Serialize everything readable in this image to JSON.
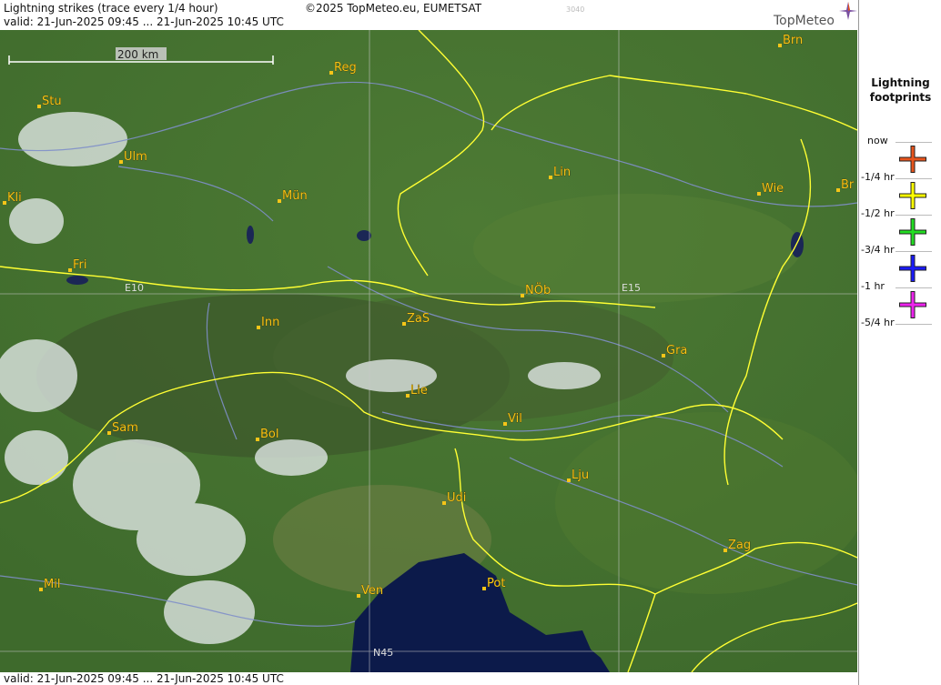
{
  "header": {
    "title": "Lightning strikes (trace every 1/4 hour)",
    "copyright": "©2025 TopMeteo.eu, EUMETSAT",
    "code": "3040",
    "valid": "valid:  21-Jun-2025 09:45 ... 21-Jun-2025 10:45 UTC",
    "logo_text": "TopMeteo"
  },
  "footer": {
    "valid": "valid:  21-Jun-2025 09:45 ... 21-Jun-2025 10:45 UTC"
  },
  "map": {
    "scale_label": "200 km",
    "grid_labels": [
      "E10",
      "E15",
      "N45"
    ],
    "cities": [
      {
        "name": "Brn"
      },
      {
        "name": "Reg"
      },
      {
        "name": "Stu"
      },
      {
        "name": "Ulm"
      },
      {
        "name": "Lin"
      },
      {
        "name": "Wie"
      },
      {
        "name": "Br"
      },
      {
        "name": "Kli"
      },
      {
        "name": "Mün"
      },
      {
        "name": "Fri"
      },
      {
        "name": "NÖb"
      },
      {
        "name": "Inn"
      },
      {
        "name": "ZaS"
      },
      {
        "name": "Gra"
      },
      {
        "name": "Lie"
      },
      {
        "name": "Vil"
      },
      {
        "name": "Sam"
      },
      {
        "name": "Bol"
      },
      {
        "name": "Lju"
      },
      {
        "name": "Udi"
      },
      {
        "name": "Zag"
      },
      {
        "name": "Mil"
      },
      {
        "name": "Ven"
      },
      {
        "name": "Pot"
      }
    ],
    "colors": {
      "border": "#ffff33",
      "rivers": "#7f8fc9",
      "grid": "#c8c8c8",
      "label": "#f5c518"
    }
  },
  "legend": {
    "title_line1": "Lightning",
    "title_line2": "footprints",
    "items": [
      {
        "label": "now",
        "color": "#e8541c"
      },
      {
        "label": "-1/4 hr",
        "color": "#ffff00"
      },
      {
        "label": "-1/2 hr",
        "color": "#22dd22"
      },
      {
        "label": "-3/4 hr",
        "color": "#1a1aff"
      },
      {
        "label": "-1 hr",
        "color": "#ee22ee"
      }
    ],
    "end_label": "-5/4 hr"
  }
}
